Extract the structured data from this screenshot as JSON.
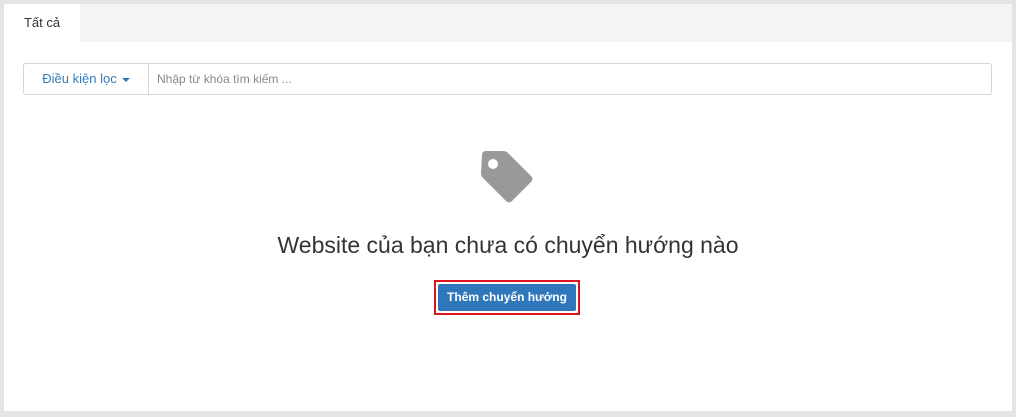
{
  "tabs": [
    {
      "label": "Tất cả",
      "active": true
    }
  ],
  "filter": {
    "button_label": "Điều kiện lọc",
    "search_placeholder": "Nhập từ khóa tìm kiếm ..."
  },
  "empty_state": {
    "icon": "tag-icon",
    "title": "Website của bạn chưa có chuyển hướng nào",
    "button_label": "Thêm chuyển hướng"
  },
  "colors": {
    "accent": "#337ab7",
    "button": "#2f76bb",
    "highlight": "#d9161d",
    "icon": "#999999"
  }
}
